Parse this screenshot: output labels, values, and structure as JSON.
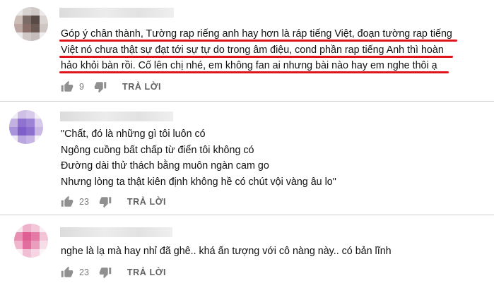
{
  "comments": [
    {
      "lines": [
        "Góp ý chân thành, Tường rap riếng anh hay hơn là ráp tiếng Việt,  đoạn tường rap tiếng",
        "Việt nó chưa thật sự đạt tới sự tự do trong âm điệu, cond phần rap tiếng Anh thì hoàn",
        "hảo khỏi bàn rồi.  Cố lên chị nhé,  em không fan ai nhưng bài nào hay em nghe thôi ạ"
      ],
      "likes": "9",
      "reply_label": "TRẢ LỜI",
      "avatar_colors": [
        "#e9e6e5",
        "#d8d2d0",
        "#cfc8c6",
        "#ece9e8",
        "#cdbdb8",
        "#7b6c67",
        "#5a4a46",
        "#d9d3d1",
        "#bda7a2",
        "#8a6f69",
        "#6b5953",
        "#cfc6c4",
        "#ece9e8",
        "#d0c8c6",
        "#c5bdbb",
        "#f0eeed"
      ]
    },
    {
      "lines": [
        "\"Chất, đó là những gì tôi luôn có",
        "Ngông cuồng bất chấp từ điển tôi không có",
        "Đường dài thử thách bằng muôn ngàn cam go",
        "Nhưng lòng ta thật kiên định không hề có chút vội vàng âu lo\""
      ],
      "likes": "23",
      "reply_label": "TRẢ LỜI",
      "avatar_colors": [
        "#f1edf7",
        "#cdbfe6",
        "#d7cbec",
        "#f3f0f8",
        "#c3b1e2",
        "#8f72cf",
        "#9d83d6",
        "#d6c9ec",
        "#a993da",
        "#7e5fc7",
        "#8c6ece",
        "#c9b8e6",
        "#efeaf6",
        "#b9a5df",
        "#c6b5e4",
        "#f4f1f9"
      ]
    },
    {
      "lines": [
        "nghe là lạ mà hay nhỉ đã ghê.. khá ấn tượng với cô nàng này.. có bản lĩnh"
      ],
      "likes": "23",
      "reply_label": "TRẢ LỜI",
      "avatar_colors": [
        "#f7e6ee",
        "#eeb3cb",
        "#f3c6d8",
        "#fbeef3",
        "#e98fb4",
        "#df5f95",
        "#e57aa6",
        "#f3c4d7",
        "#f0b6cd",
        "#e26e9f",
        "#eb9dbe",
        "#f7dde8",
        "#fcf0f5",
        "#f1bfd3",
        "#f6d4e2",
        "#fdf4f8"
      ]
    }
  ]
}
